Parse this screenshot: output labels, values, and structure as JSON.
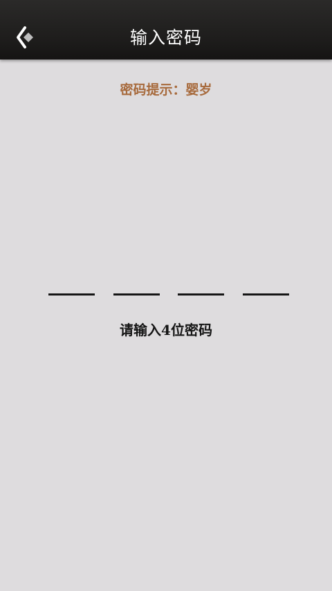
{
  "header": {
    "title": "输入密码",
    "back_icon": "back-chevron-icon"
  },
  "hint": {
    "text": "密码提示：婴岁"
  },
  "pin": {
    "length": 4,
    "entered": 0,
    "instruction": "请输入4位密码"
  },
  "colors": {
    "background": "#dedcde",
    "header_bg": "#1d1c1b",
    "hint_text": "#a76a3c",
    "pin_line": "#151515"
  }
}
